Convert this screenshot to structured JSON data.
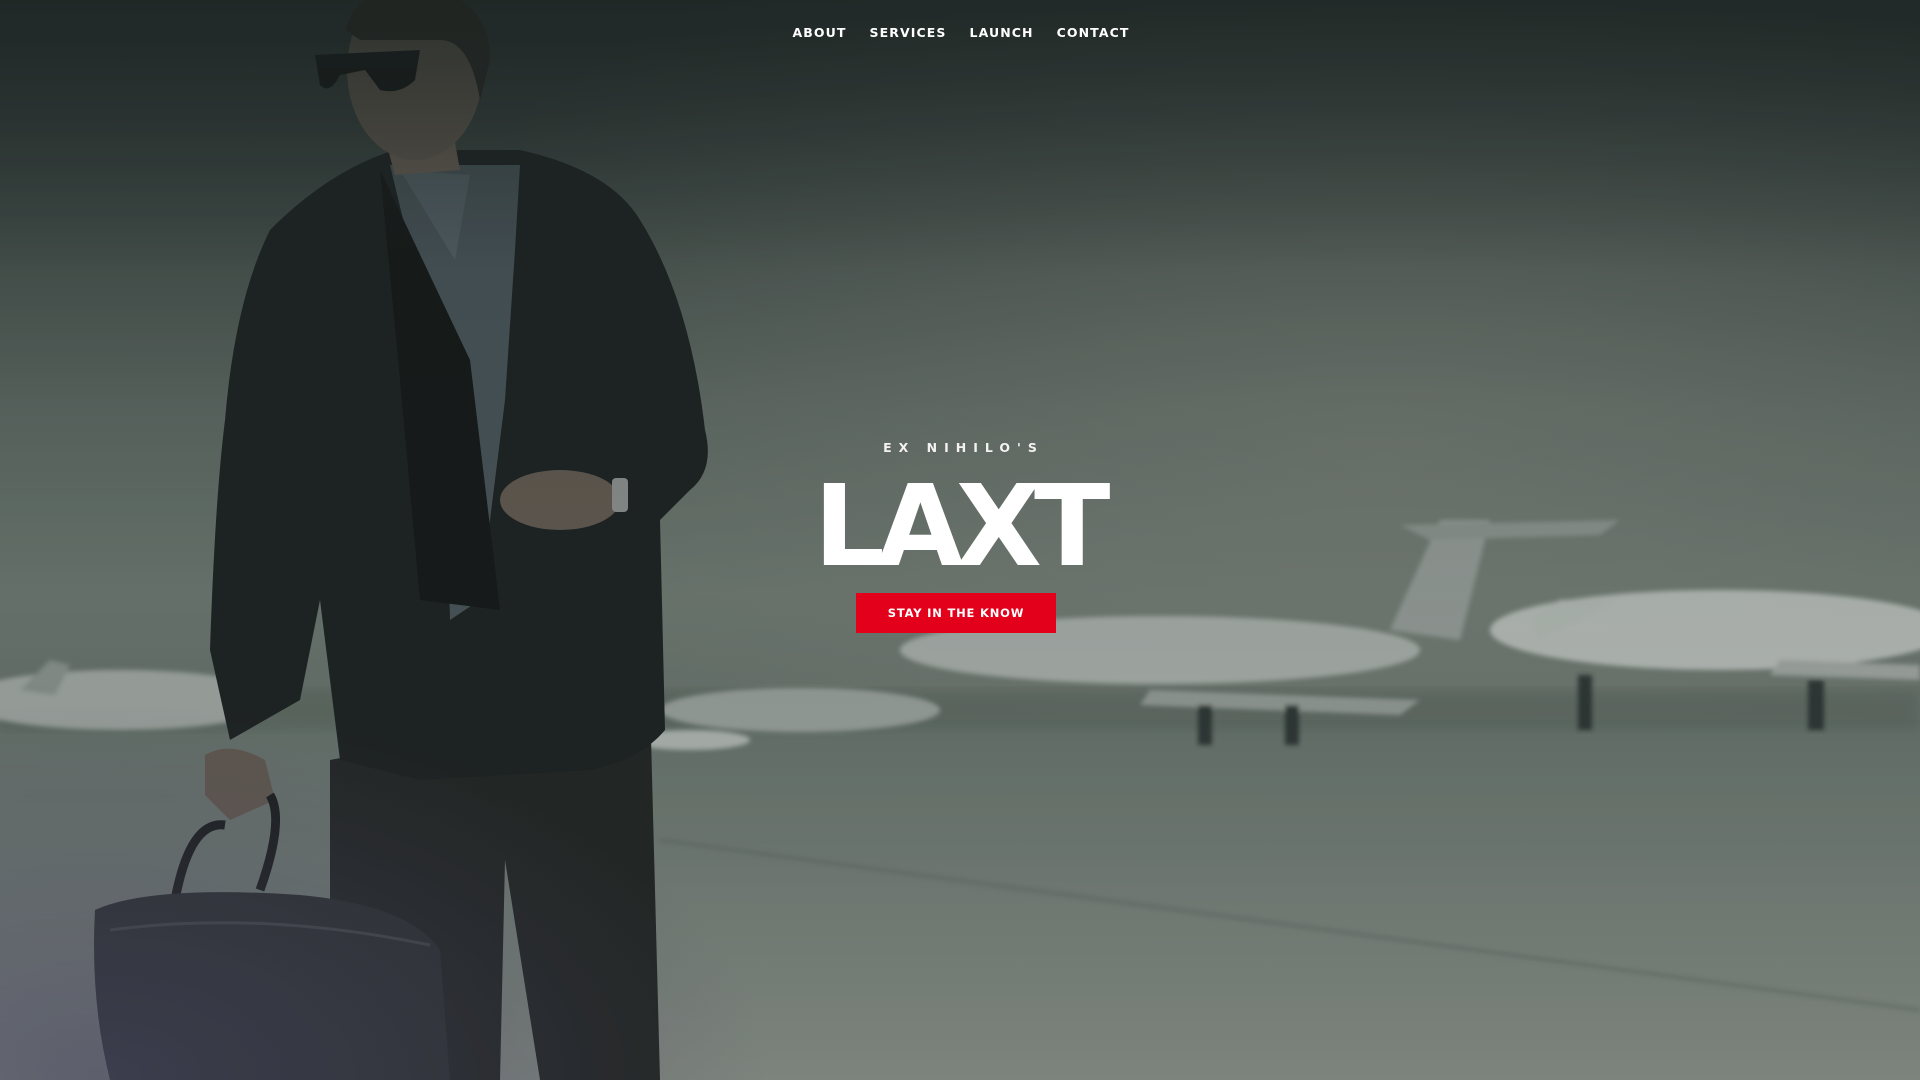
{
  "nav": {
    "items": [
      {
        "label": "ABOUT"
      },
      {
        "label": "SERVICES"
      },
      {
        "label": "LAUNCH"
      },
      {
        "label": "CONTACT"
      }
    ]
  },
  "hero": {
    "eyebrow": "EX NIHILO'S",
    "title": "LAXT",
    "cta_label": "STAY IN THE KNOW",
    "background_description": "man-in-suit-with-bag-on-airport-tarmac-with-private-jets"
  },
  "colors": {
    "accent": "#e3001b",
    "text": "#ffffff"
  }
}
